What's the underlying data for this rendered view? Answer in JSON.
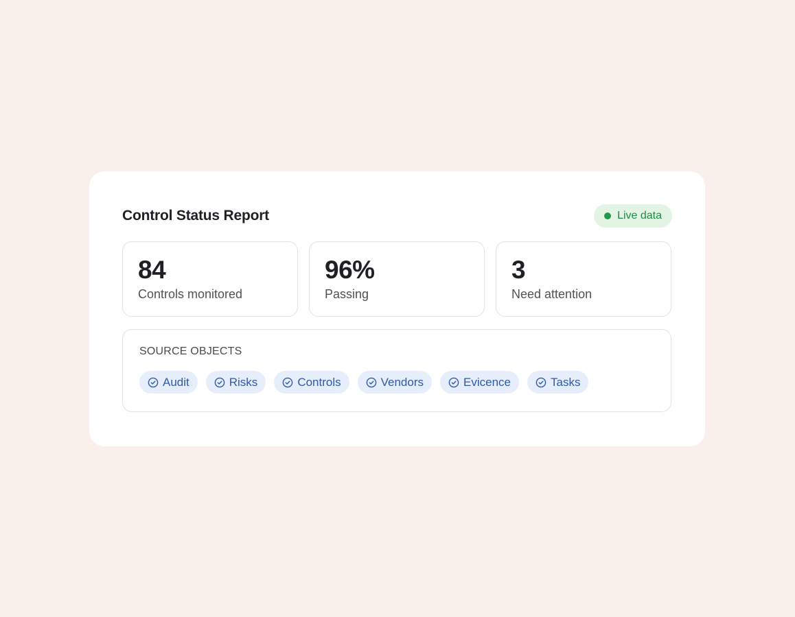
{
  "report": {
    "title": "Control Status Report",
    "live_badge": {
      "label": "Live data",
      "dot_color": "#1f9a4a"
    },
    "stats": [
      {
        "value": "84",
        "label": "Controls monitored"
      },
      {
        "value": "96%",
        "label": "Passing"
      },
      {
        "value": "3",
        "label": "Need attention"
      }
    ],
    "sources": {
      "heading": "SOURCE OBJECTS",
      "chip_icon": "check-circle-icon",
      "chips": [
        {
          "label": "Audit"
        },
        {
          "label": "Risks"
        },
        {
          "label": "Controls"
        },
        {
          "label": "Vendors"
        },
        {
          "label": "Evicence"
        },
        {
          "label": "Tasks"
        }
      ]
    }
  },
  "colors": {
    "page_background": "#f9efeb",
    "panel_background": "#ffffff",
    "live_badge_background": "#e3f3e4",
    "live_text": "#1f8a44",
    "chip_background": "#e6eefb",
    "chip_text": "#2f5aa8"
  }
}
